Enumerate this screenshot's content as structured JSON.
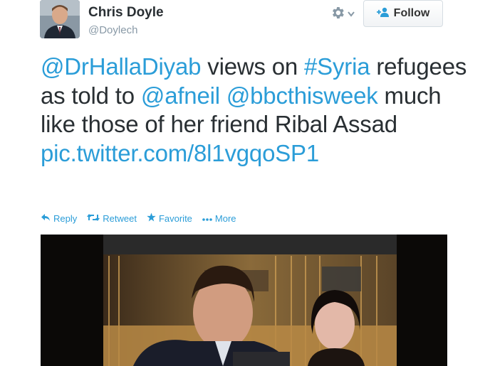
{
  "user": {
    "name": "Chris Doyle",
    "handle": "@Doylech"
  },
  "follow_label": "Follow",
  "tweet": {
    "parts": [
      {
        "text": "@DrHallaDiyab",
        "link": true
      },
      {
        "text": " views on ",
        "link": false
      },
      {
        "text": "#Syria",
        "link": true
      },
      {
        "text": " refugees as told to ",
        "link": false
      },
      {
        "text": "@afneil",
        "link": true
      },
      {
        "text": " ",
        "link": false
      },
      {
        "text": "@bbcthisweek",
        "link": true
      },
      {
        "text": " much like those of her friend Ribal Assad ",
        "link": false
      },
      {
        "text": "pic.twitter.com/8l1vgqoSP1",
        "link": true
      }
    ]
  },
  "actions": {
    "reply": "Reply",
    "retweet": "Retweet",
    "favorite": "Favorite",
    "more": "More"
  },
  "colors": {
    "link": "#2b9dd8",
    "text": "#292f33",
    "muted": "#8899a6"
  },
  "icons": [
    "settings-gear-icon",
    "chevron-down-icon",
    "add-person-icon",
    "reply-icon",
    "retweet-icon",
    "star-icon",
    "more-dots-icon"
  ]
}
